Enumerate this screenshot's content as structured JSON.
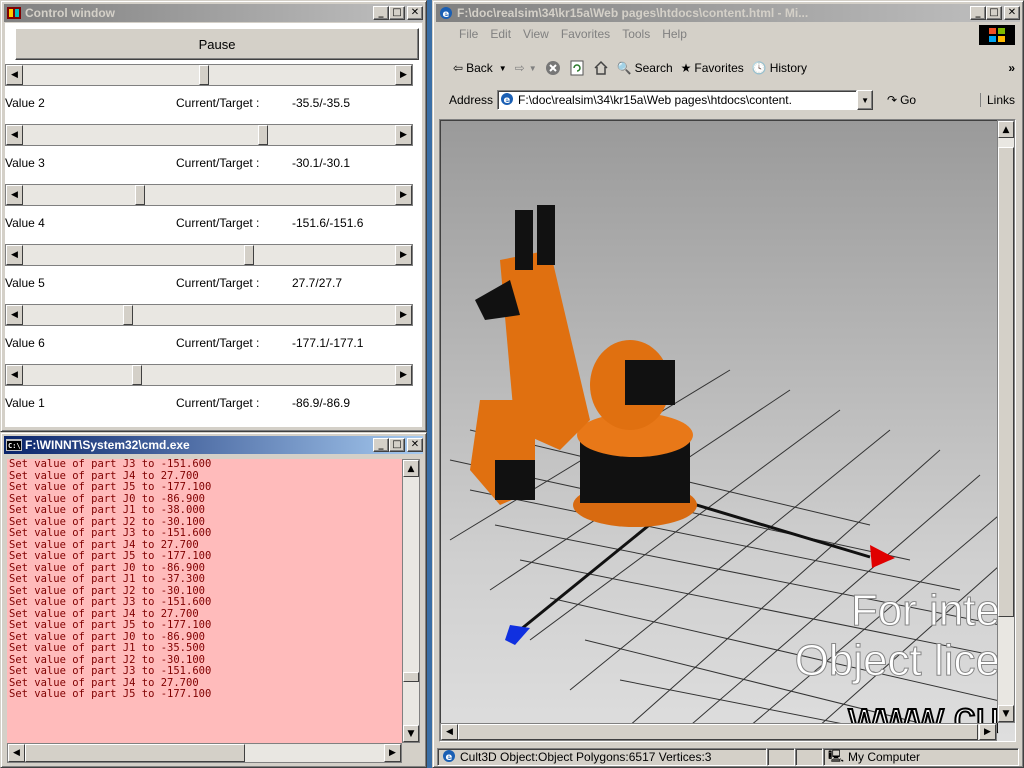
{
  "control_window": {
    "title": "Control window",
    "pause_label": "Pause",
    "rows": [
      {
        "label": "Value 2",
        "ct_label": "Current/Target :",
        "value": "-35.5/-35.5"
      },
      {
        "label": "Value 3",
        "ct_label": "Current/Target :",
        "value": "-30.1/-30.1"
      },
      {
        "label": "Value 4",
        "ct_label": "Current/Target :",
        "value": "-151.6/-151.6"
      },
      {
        "label": "Value 5",
        "ct_label": "Current/Target :",
        "value": "27.7/27.7"
      },
      {
        "label": "Value 6",
        "ct_label": "Current/Target :",
        "value": "-177.1/-177.1"
      },
      {
        "label": "Value 1",
        "ct_label": "Current/Target :",
        "value": "-86.9/-86.9"
      }
    ],
    "slider_positions": [
      0.485,
      0.65,
      0.31,
      0.61,
      0.275,
      0.3
    ]
  },
  "cmd_window": {
    "title": "F:\\WINNT\\System32\\cmd.exe",
    "lines": [
      "Set value of part J3 to -151.600",
      "Set value of part J4 to 27.700",
      "Set value of part J5 to -177.100",
      "Set value of part J0 to -86.900",
      "Set value of part J1 to -38.000",
      "Set value of part J2 to -30.100",
      "Set value of part J3 to -151.600",
      "Set value of part J4 to 27.700",
      "Set value of part J5 to -177.100",
      "Set value of part J0 to -86.900",
      "Set value of part J1 to -37.300",
      "Set value of part J2 to -30.100",
      "Set value of part J3 to -151.600",
      "Set value of part J4 to 27.700",
      "Set value of part J5 to -177.100",
      "Set value of part J0 to -86.900",
      "Set value of part J1 to -35.500",
      "Set value of part J2 to -30.100",
      "Set value of part J3 to -151.600",
      "Set value of part J4 to 27.700",
      "Set value of part J5 to -177.100"
    ]
  },
  "browser": {
    "title": "F:\\doc\\realsim\\34\\kr15a\\Web pages\\htdocs\\content.html - Mi...",
    "menu": [
      "File",
      "Edit",
      "View",
      "Favorites",
      "Tools",
      "Help"
    ],
    "toolbar": {
      "back": "Back",
      "search": "Search",
      "favorites": "Favorites",
      "history": "History",
      "more": "»"
    },
    "address_label": "Address",
    "address_value": "F:\\doc\\realsim\\34\\kr15a\\Web pages\\htdocs\\content.",
    "go_label": "Go",
    "links_label": "Links",
    "overlay_lines": [
      "For inte",
      "Object lice",
      "www.cu"
    ],
    "status_text": "Cult3D Object:Object Polygons:6517 Vertices:3",
    "zone_text": "My Computer"
  }
}
